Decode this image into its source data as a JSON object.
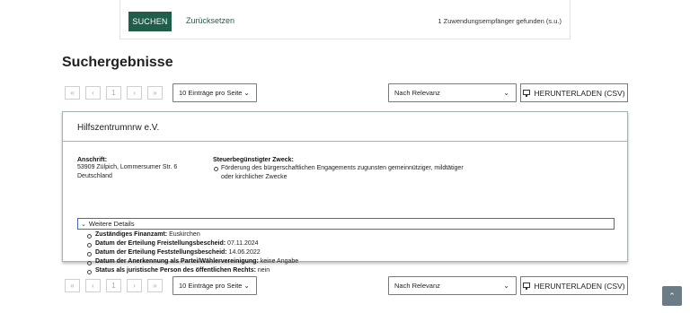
{
  "search": {
    "submit_label": "SUCHEN",
    "reset_label": "Zurücksetzen",
    "result_summary": "1 Zuwendungsempfänger gefunden (s.u.)"
  },
  "results": {
    "title": "Suchergebnisse",
    "pager": {
      "first": "«",
      "prev": "‹",
      "page": "1",
      "next": "›",
      "last": "»"
    },
    "per_page": "10 Einträge pro Seite",
    "sort": "Nach Relevanz",
    "download_label": "HERUNTERLADEN (CSV)"
  },
  "card": {
    "name": "Hilfszentrumnrw e.V.",
    "address_label": "Anschrift:",
    "address_lines": [
      "53909 Zülpich, Lommersumer Str. 6",
      "Deutschland"
    ],
    "purpose_label": "Steuerbegünstigter Zweck:",
    "purpose_lines": [
      "Förderung des bürgerschaftlichen Engagements zugunsten gemeinnütziger, mildtätiger",
      "oder kirchlicher Zwecke"
    ],
    "details_label": "Weitere Details",
    "details": [
      {
        "label": "Zuständiges Finanzamt:",
        "value": "Euskirchen"
      },
      {
        "label": "Datum der Erteilung Freistellungsbescheid:",
        "value": "07.11.2024"
      },
      {
        "label": "Datum der Erteilung Feststellungsbescheid:",
        "value": "14.06.2022"
      },
      {
        "label": "Datum der Anerkennung als Partei/Wählervereinigung:",
        "value": "keine Angabe"
      },
      {
        "label": "Status als juristische Person des öffentlichen Rechts:",
        "value": "nein"
      }
    ]
  },
  "icons": {
    "select_chevron": "chevron-down-icon",
    "download": "monitor-icon",
    "scroll_top": "arrow-up-icon"
  },
  "colors": {
    "primary": "#1f5e4a",
    "card_border": "#9db5ab",
    "focus": "#3d6fb3",
    "scroll_top_bg": "#6b7c87"
  }
}
